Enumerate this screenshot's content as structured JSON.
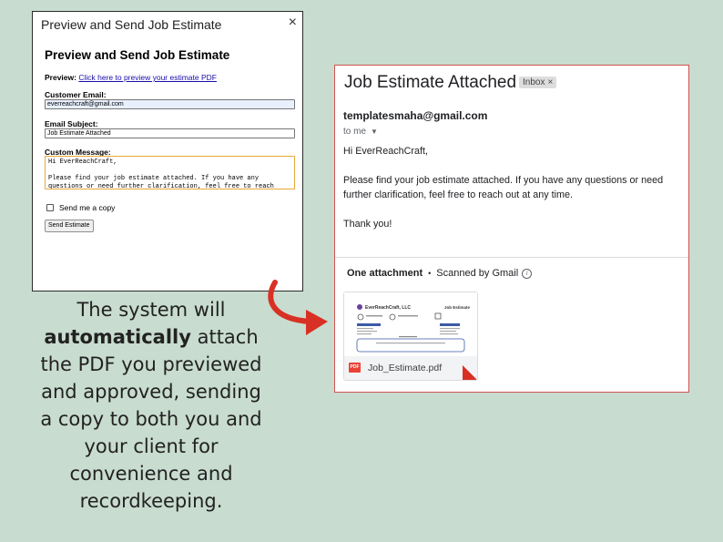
{
  "dialog": {
    "title": "Preview and Send Job Estimate",
    "close_icon": "×",
    "heading": "Preview and Send Job Estimate",
    "preview_label": "Preview:",
    "preview_link": "Click here to preview your estimate PDF",
    "email_label": "Customer Email:",
    "email_value": "everreachcraft@gmail.com",
    "subject_label": "Email Subject:",
    "subject_value": "Job Estimate Attached",
    "message_label": "Custom Message:",
    "message_value": "Hi EverReachCraft,\n\nPlease find your job estimate attached. If you have any questions or need further clarification, feel free to reach",
    "copy_label": "Send me a copy",
    "copy_checked": false,
    "send_button": "Send Estimate"
  },
  "caption": {
    "line1": "The system will",
    "bold": "automatically",
    "line2_rest": " attach",
    "line3": "the PDF you previewed",
    "line4": "and approved, sending",
    "line5": "a copy to both you and",
    "line6": "your client for",
    "line7": "convenience and",
    "line8": "recordkeeping."
  },
  "email": {
    "subject": "Job Estimate Attached",
    "inbox_badge": "Inbox",
    "inbox_close": "×",
    "sender": "templatesmaha@gmail.com",
    "to": "to me",
    "greeting": "Hi EverReachCraft,",
    "body": "Please find your job estimate attached. If you have any questions or need further clarification, feel free to reach out at any time.",
    "closing": "Thank you!",
    "attachment_header": "One attachment",
    "scanned": "Scanned by Gmail",
    "attachment": {
      "filename": "Job_Estimate.pdf",
      "badge": "PDF",
      "thumb_company": "EverReachCraft, LLC",
      "thumb_title": "Job Estimate"
    }
  },
  "colors": {
    "background": "#c8dccf",
    "email_border": "#d0554d",
    "arrow": "#d93025",
    "link": "#1a0dab"
  },
  "icons": {
    "dialog_close": "close-icon",
    "arrow": "curved-arrow-icon",
    "info": "info-icon",
    "pdf": "pdf-icon",
    "caret": "chevron-down-icon"
  }
}
